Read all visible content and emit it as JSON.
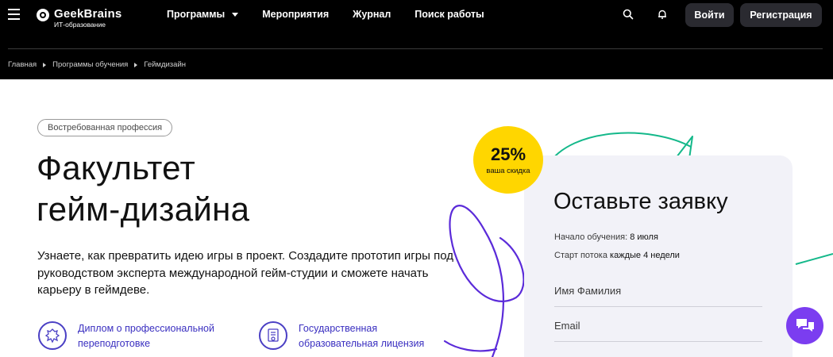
{
  "header": {
    "logo": {
      "name": "GeekBrains",
      "subtitle": "ИТ-образование"
    },
    "nav": [
      {
        "label": "Программы",
        "has_dropdown": true
      },
      {
        "label": "Мероприятия"
      },
      {
        "label": "Журнал"
      },
      {
        "label": "Поиск работы"
      }
    ],
    "icons": [
      "menu-icon",
      "search-icon",
      "bell-icon"
    ],
    "login_label": "Войти",
    "register_label": "Регистрация"
  },
  "breadcrumb": [
    "Главная",
    "Программы обучения",
    "Геймдизайн"
  ],
  "hero": {
    "badge": "Востребованная профессия",
    "title_line1": "Факультет",
    "title_line2": "гейм-дизайна",
    "description": "Узнаете, как превратить идею игры в проект. Создадите прототип игры под руководством эксперта международной гейм-студии и сможете начать карьеру в геймдеве.",
    "features": [
      {
        "icon": "emblem-icon",
        "line1": "Диплом о профессиональной",
        "line2": "переподготовке"
      },
      {
        "icon": "certificate-icon",
        "line1": "Государственная",
        "line2": "образовательная лицензия"
      }
    ]
  },
  "discount": {
    "percent": "25%",
    "label": "ваша скидка"
  },
  "form": {
    "title": "Оставьте заявку",
    "start_label": "Начало обучения:",
    "start_value": "8 июля",
    "stream_label": "Старт потока",
    "stream_value": "каждые 4 недели",
    "name_placeholder": "Имя Фамилия",
    "email_placeholder": "Email"
  },
  "colors": {
    "header_bg": "#000000",
    "accent_purple": "#5b2bd9",
    "accent_green": "#14b88a",
    "discount_yellow": "#ffd600",
    "chat_purple": "#7b3df0",
    "link_blue": "#3a2fc0"
  }
}
